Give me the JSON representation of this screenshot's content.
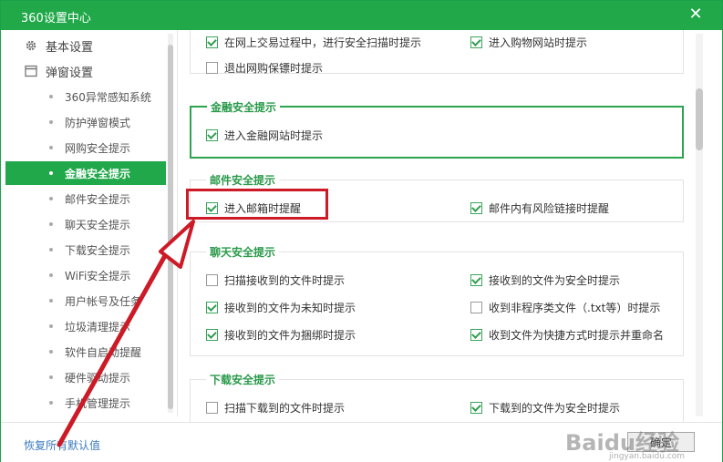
{
  "window": {
    "title": "360设置中心",
    "close_glyph": "✕"
  },
  "sidebar": {
    "top_items": [
      {
        "label": "基本设置",
        "icon": "gear-icon"
      },
      {
        "label": "弹窗设置",
        "icon": "window-icon"
      }
    ],
    "sub_items": [
      {
        "label": "360异常感知系统",
        "active": false
      },
      {
        "label": "防护弹窗模式",
        "active": false
      },
      {
        "label": "网购安全提示",
        "active": false
      },
      {
        "label": "金融安全提示",
        "active": true
      },
      {
        "label": "邮件安全提示",
        "active": false
      },
      {
        "label": "聊天安全提示",
        "active": false
      },
      {
        "label": "下载安全提示",
        "active": false
      },
      {
        "label": "WiFi安全提示",
        "active": false
      },
      {
        "label": "用户帐号及任务",
        "active": false
      },
      {
        "label": "垃圾清理提示",
        "active": false
      },
      {
        "label": "软件自启动提醒",
        "active": false
      },
      {
        "label": "硬件驱动提示",
        "active": false
      },
      {
        "label": "手机管理提示",
        "active": false
      }
    ]
  },
  "sections": {
    "shopping_partial": {
      "options": [
        {
          "label": "在网上交易过程中，进行安全扫描时提示",
          "checked": true
        },
        {
          "label": "进入购物网站时提示",
          "checked": true
        },
        {
          "label": "退出网购保镖时提示",
          "checked": false
        }
      ]
    },
    "finance": {
      "title": "金融安全提示",
      "options": [
        {
          "label": "进入金融网站时提示",
          "checked": true
        }
      ]
    },
    "mail": {
      "title": "邮件安全提示",
      "options": [
        {
          "label": "进入邮箱时提醒",
          "checked": true
        },
        {
          "label": "邮件内有风险链接时提醒",
          "checked": true
        }
      ]
    },
    "chat": {
      "title": "聊天安全提示",
      "options": [
        {
          "label": "扫描接收到的文件时提示",
          "checked": false
        },
        {
          "label": "接收到的文件为安全时提示",
          "checked": true
        },
        {
          "label": "接收到的文件为未知时提示",
          "checked": true
        },
        {
          "label": "收到非程序类文件（.txt等）时提示",
          "checked": false
        },
        {
          "label": "接收到的文件为捆绑时提示",
          "checked": true
        },
        {
          "label": "收到文件为快捷方式时提示并重命名",
          "checked": true
        }
      ]
    },
    "download": {
      "title": "下载安全提示",
      "options": [
        {
          "label": "扫描下载到的文件时提示",
          "checked": false
        },
        {
          "label": "下载到的文件为安全时提示",
          "checked": true
        }
      ]
    }
  },
  "footer": {
    "restore_label": "恢复所有默认值",
    "ok_label": "确定"
  },
  "watermark": {
    "text": "Baidu经验",
    "sub": "jingyan.baidu.com"
  },
  "colors": {
    "brand_green": "#20a849",
    "highlight_red": "#cc1a26",
    "link_blue": "#3a7bbf"
  }
}
